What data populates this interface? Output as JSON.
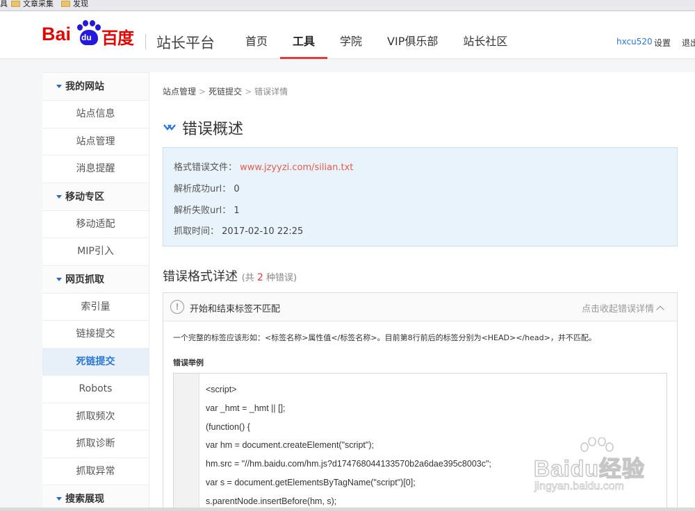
{
  "bookmarks": [
    "具",
    "文章采集",
    "发现"
  ],
  "logo": {
    "bai": "Bai",
    "du": "du",
    "cn": "百度"
  },
  "header": {
    "site_title": "站长平台",
    "nav": [
      "首页",
      "工具",
      "学院",
      "VIP俱乐部",
      "站长社区"
    ],
    "active_nav": "工具",
    "user": "hxcu520",
    "settings": "设置",
    "logout": "退出"
  },
  "sidebar": {
    "groups": [
      {
        "label": "我的网站",
        "items": [
          "站点信息",
          "站点管理",
          "消息提醒"
        ]
      },
      {
        "label": "移动专区",
        "items": [
          "移动适配",
          "MIP引入"
        ]
      },
      {
        "label": "网页抓取",
        "items": [
          "索引量",
          "链接提交",
          "死链提交",
          "Robots",
          "抓取频次",
          "抓取诊断",
          "抓取异常"
        ]
      },
      {
        "label": "搜索展现",
        "items": []
      }
    ],
    "active_item": "死链提交"
  },
  "breadcrumb": [
    "站点管理",
    "死链提交",
    "错误详情"
  ],
  "overview": {
    "title": "错误概述",
    "rows": [
      {
        "label": "格式错误文件：",
        "value": "www.jzyyzi.com/silian.txt"
      },
      {
        "label": "解析成功url：",
        "value": "0"
      },
      {
        "label": "解析失败url：",
        "value": "1"
      },
      {
        "label": "抓取时间：",
        "value": "2017-02-10 22:25"
      }
    ]
  },
  "format_details": {
    "title": "错误格式详述",
    "count_prefix": "(共",
    "count": "2",
    "count_suffix": "种错误)",
    "error": {
      "name": "开始和结束标签不匹配",
      "collapse_label": "点击收起错误详情",
      "description": "一个完整的标签应该形如：<标签名称>属性值</标签名称>。目前第8行前后的标签分别为<HEAD></head>，并不匹配。",
      "example_title": "错误举例",
      "code_lines": [
        "<script>",
        "var _hmt = _hmt || [];",
        "(function() {",
        "var hm = document.createElement(\"script\");",
        "hm.src = \"//hm.baidu.com/hm.js?d174768044133570b2a6dae395c8003c\";",
        "var s = document.getElementsByTagName(\"script\")[0];",
        "s.parentNode.insertBefore(hm, s);"
      ]
    }
  },
  "watermark": {
    "text": "Baidu经验",
    "url": "jingyan.baidu.com"
  }
}
